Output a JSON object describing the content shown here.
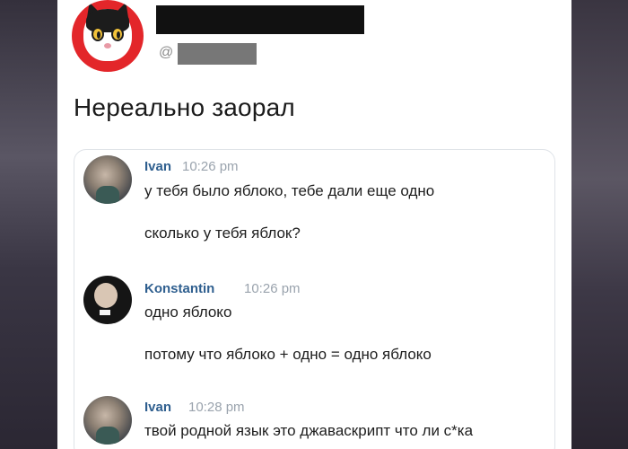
{
  "tweet": {
    "handle_prefix": "@",
    "text": "Нереально заорал"
  },
  "messages": [
    {
      "author": "Ivan",
      "time": "10:26 pm",
      "lines": [
        "у тебя было яблоко, тебе дали еще одно",
        "сколько у тебя яблок?"
      ]
    },
    {
      "author": "Konstantin",
      "time": "10:26 pm",
      "lines": [
        "одно яблоко",
        "потому что яблоко + одно = одно яблоко"
      ]
    },
    {
      "author": "Ivan",
      "time": "10:28 pm",
      "lines": [
        "твой родной язык это джаваскрипт что ли с*ка"
      ]
    }
  ],
  "colors": {
    "author_link": "#2f5f8f",
    "timestamp": "#9aa3ad",
    "avatar_red": "#e3262a"
  }
}
